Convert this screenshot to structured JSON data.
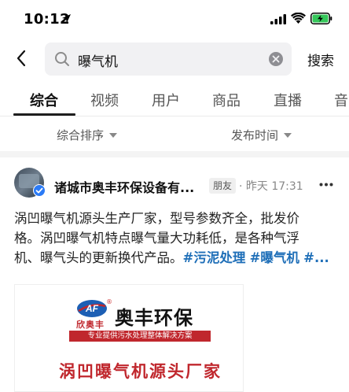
{
  "status_bar": {
    "time": "10:12"
  },
  "search": {
    "query": "曝气机",
    "button_label": "搜索"
  },
  "tabs": [
    {
      "label": "综合",
      "active": true
    },
    {
      "label": "视频",
      "active": false
    },
    {
      "label": "用户",
      "active": false
    },
    {
      "label": "商品",
      "active": false
    },
    {
      "label": "直播",
      "active": false
    },
    {
      "label": "音",
      "active": false
    }
  ],
  "sort_bar": {
    "sort_label": "综合排序",
    "time_label": "发布时间"
  },
  "post": {
    "author": "诸城市奥丰环保设备有...",
    "badge": "朋友",
    "time": "· 昨天 17:31",
    "body_lines": [
      "涡凹曝气机源头生产厂家，型号参数齐全，批发价",
      "格。涡凹曝气机特点曝气量大功耗低，是各种气浮"
    ],
    "body_line3_text": "机、曝气头的更新换代产品。",
    "hashtags": [
      "#污泥处理",
      "#曝气机",
      "#..."
    ],
    "image": {
      "logo_letters": "AF",
      "logo_registered": "®",
      "logo_sub": "欣奥丰",
      "company_name": "奥丰环保",
      "tagline": "专业提供污水处理整体解决方案",
      "slogan": "涡凹曝气机源头厂家"
    }
  },
  "colors": {
    "hashtag": "#1f6fb8",
    "brand_red": "#c0272d",
    "search_bg": "#f1f1f3"
  }
}
